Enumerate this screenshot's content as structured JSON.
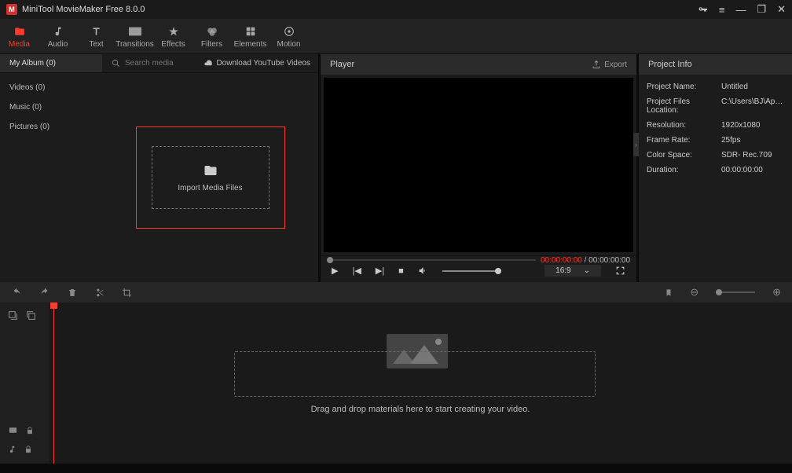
{
  "titlebar": {
    "title": "MiniTool MovieMaker Free 8.0.0"
  },
  "nav": {
    "media": "Media",
    "audio": "Audio",
    "text": "Text",
    "transitions": "Transitions",
    "effects": "Effects",
    "filters": "Filters",
    "elements": "Elements",
    "motion": "Motion"
  },
  "media": {
    "album": "My Album (0)",
    "search_placeholder": "Search media",
    "download": "Download YouTube Videos",
    "side": {
      "videos": "Videos (0)",
      "music": "Music (0)",
      "pictures": "Pictures (0)"
    },
    "import": "Import Media Files"
  },
  "player": {
    "title": "Player",
    "export": "Export",
    "timecurrent": "00:00:00:00",
    "timesep": " / ",
    "timetotal": "00:00:00:00",
    "aspect": "16:9"
  },
  "info": {
    "title": "Project Info",
    "rows": {
      "name_k": "Project Name:",
      "name_v": "Untitled",
      "loc_k": "Project Files Location:",
      "loc_v": "C:\\Users\\BJ\\App...",
      "res_k": "Resolution:",
      "res_v": "1920x1080",
      "fps_k": "Frame Rate:",
      "fps_v": "25fps",
      "cs_k": "Color Space:",
      "cs_v": "SDR- Rec.709",
      "dur_k": "Duration:",
      "dur_v": "00:00:00:00"
    }
  },
  "timeline": {
    "hint": "Drag and drop materials here to start creating your video."
  }
}
